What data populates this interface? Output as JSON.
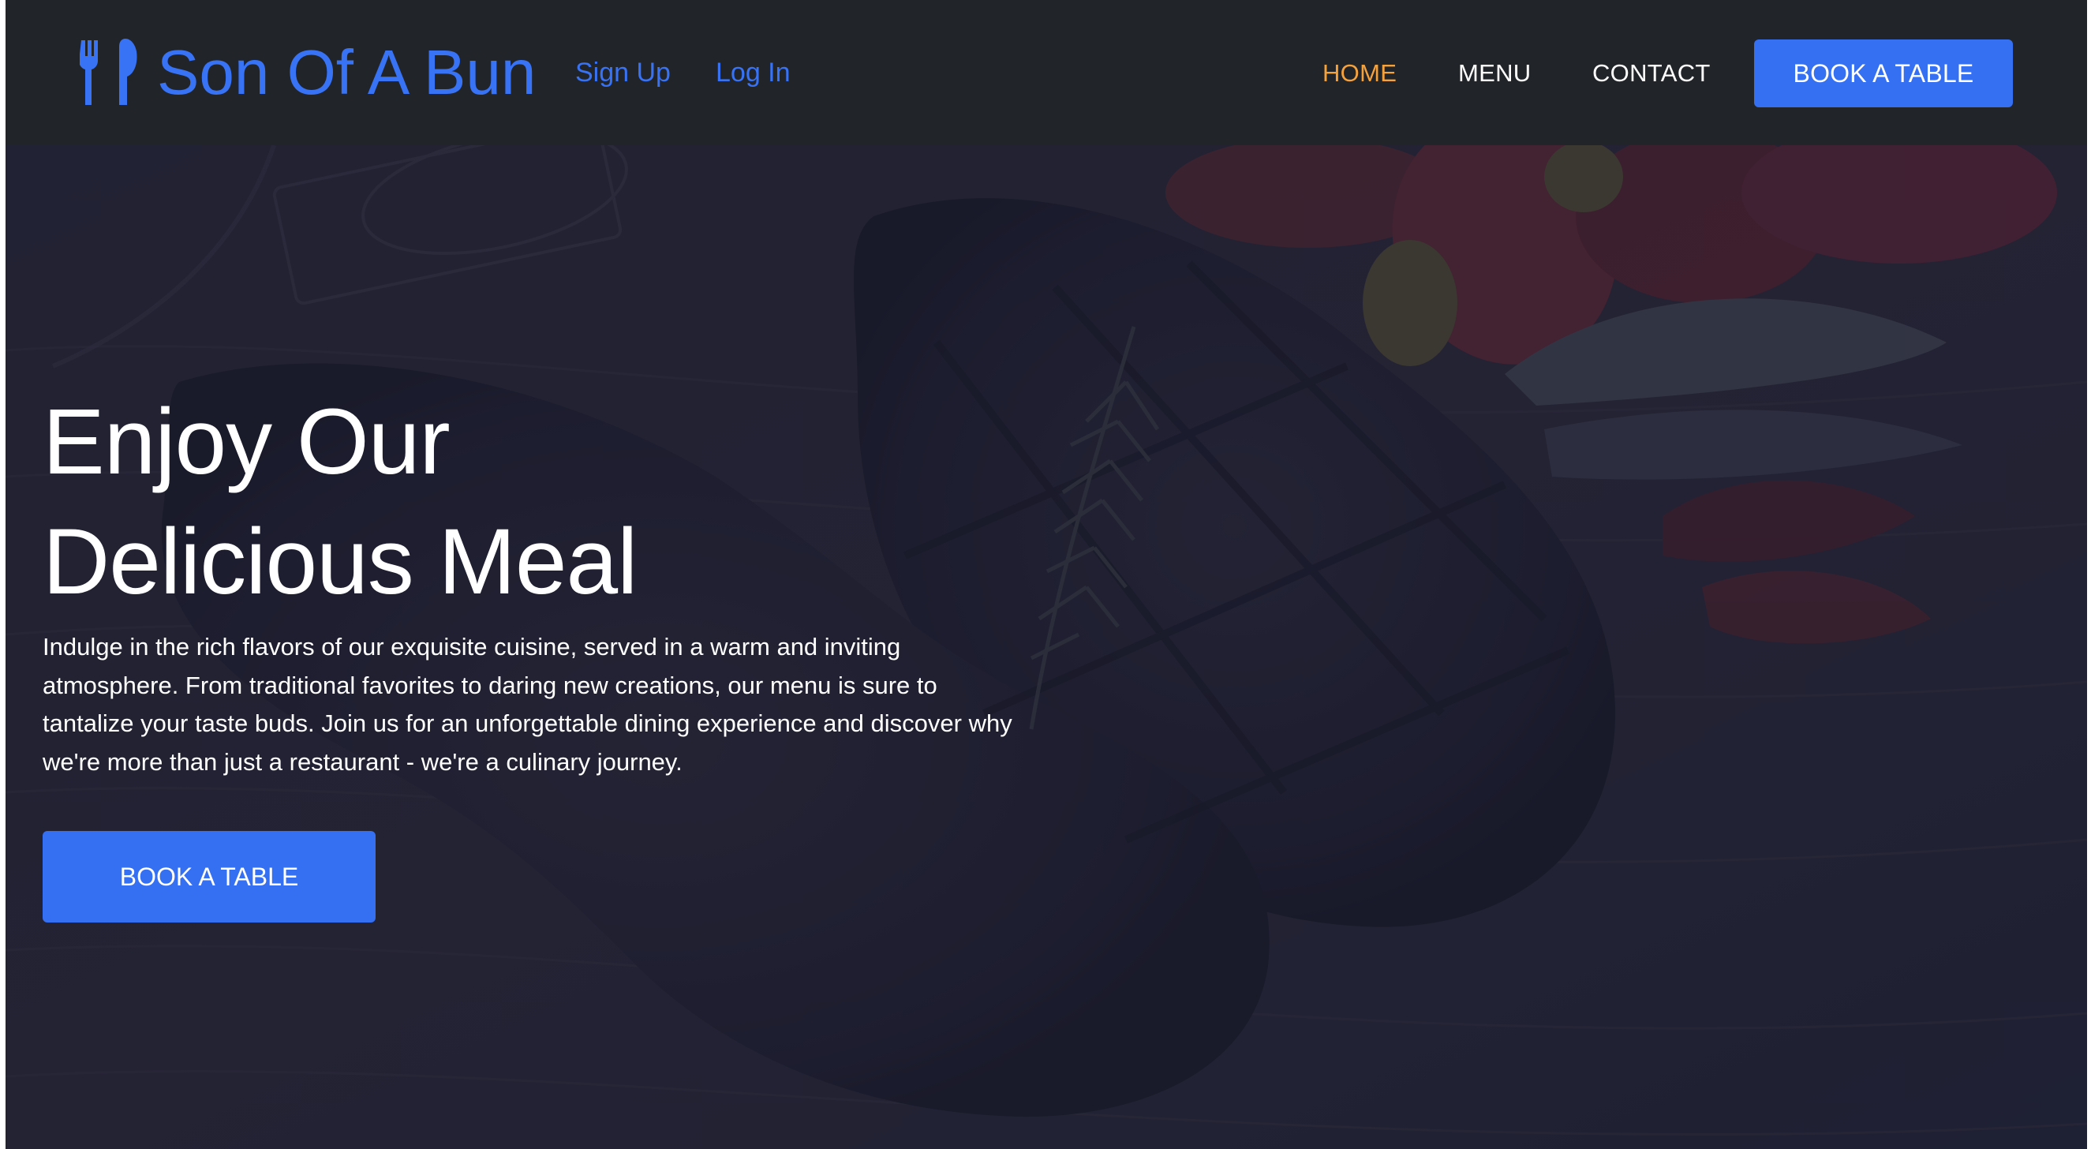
{
  "brand": {
    "name": "Son Of A Bun",
    "icon": "utensils-icon",
    "color": "#3873f5"
  },
  "auth": {
    "signup_label": "Sign Up",
    "login_label": "Log In"
  },
  "nav": {
    "items": [
      {
        "label": "HOME",
        "active": true,
        "color": "#f5a23d"
      },
      {
        "label": "MENU",
        "active": false
      },
      {
        "label": "CONTACT",
        "active": false
      }
    ],
    "book_label": "BOOK A TABLE"
  },
  "hero": {
    "title_line1": "Enjoy Our",
    "title_line2": "Delicious Meal",
    "description": "Indulge in the rich flavors of our exquisite cuisine, served in a warm and inviting atmosphere. From traditional favorites to daring new creations, our menu is sure to tantalize your taste buds. Join us for an unforgettable dining experience and discover why we're more than just a restaurant - we're a culinary journey.",
    "cta_label": "BOOK A TABLE",
    "background": "steak-on-wooden-board-image"
  },
  "colors": {
    "accent": "#356ff2",
    "navbar_bg": "#212429",
    "active_nav": "#f5a23d"
  }
}
